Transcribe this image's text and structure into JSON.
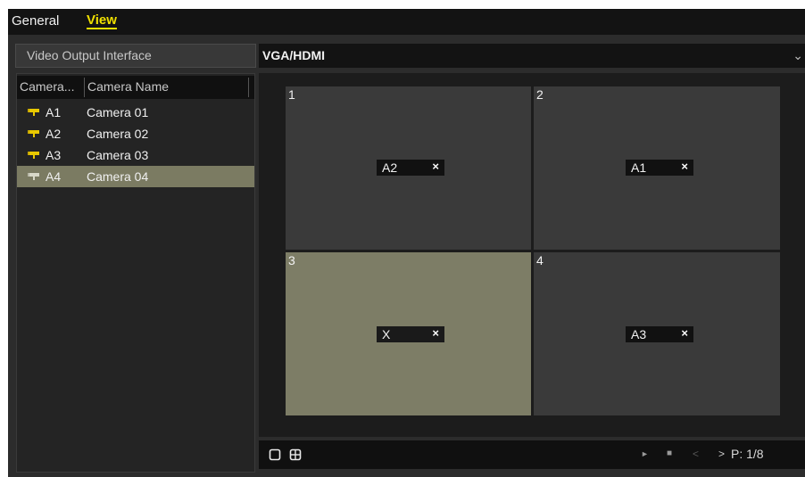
{
  "tabs": [
    {
      "label": "General"
    },
    {
      "label": "View"
    }
  ],
  "output": {
    "label": "Video Output Interface",
    "value": "VGA/HDMI"
  },
  "camera_list": {
    "headers": [
      "Camera...",
      "Camera Name"
    ],
    "rows": [
      {
        "id": "A1",
        "name": "Camera 01",
        "selected": false
      },
      {
        "id": "A2",
        "name": "Camera 02",
        "selected": false
      },
      {
        "id": "A3",
        "name": "Camera 03",
        "selected": false
      },
      {
        "id": "A4",
        "name": "Camera 04",
        "selected": true
      }
    ]
  },
  "grid": {
    "cells": [
      {
        "number": "1",
        "assigned": "A2"
      },
      {
        "number": "2",
        "assigned": "A1"
      },
      {
        "number": "3",
        "assigned": "X"
      },
      {
        "number": "4",
        "assigned": "A3"
      }
    ],
    "selected_cell": "3",
    "remove_glyph": "×"
  },
  "toolbar": {
    "page_label": "P: 1/8",
    "prev_glyph": "<",
    "next_glyph": ">",
    "play_glyph": "►",
    "stop_glyph": "■"
  },
  "colors": {
    "accent": "#f0e000",
    "selection": "#7b7b62",
    "camera_icon": "#e8c800"
  }
}
